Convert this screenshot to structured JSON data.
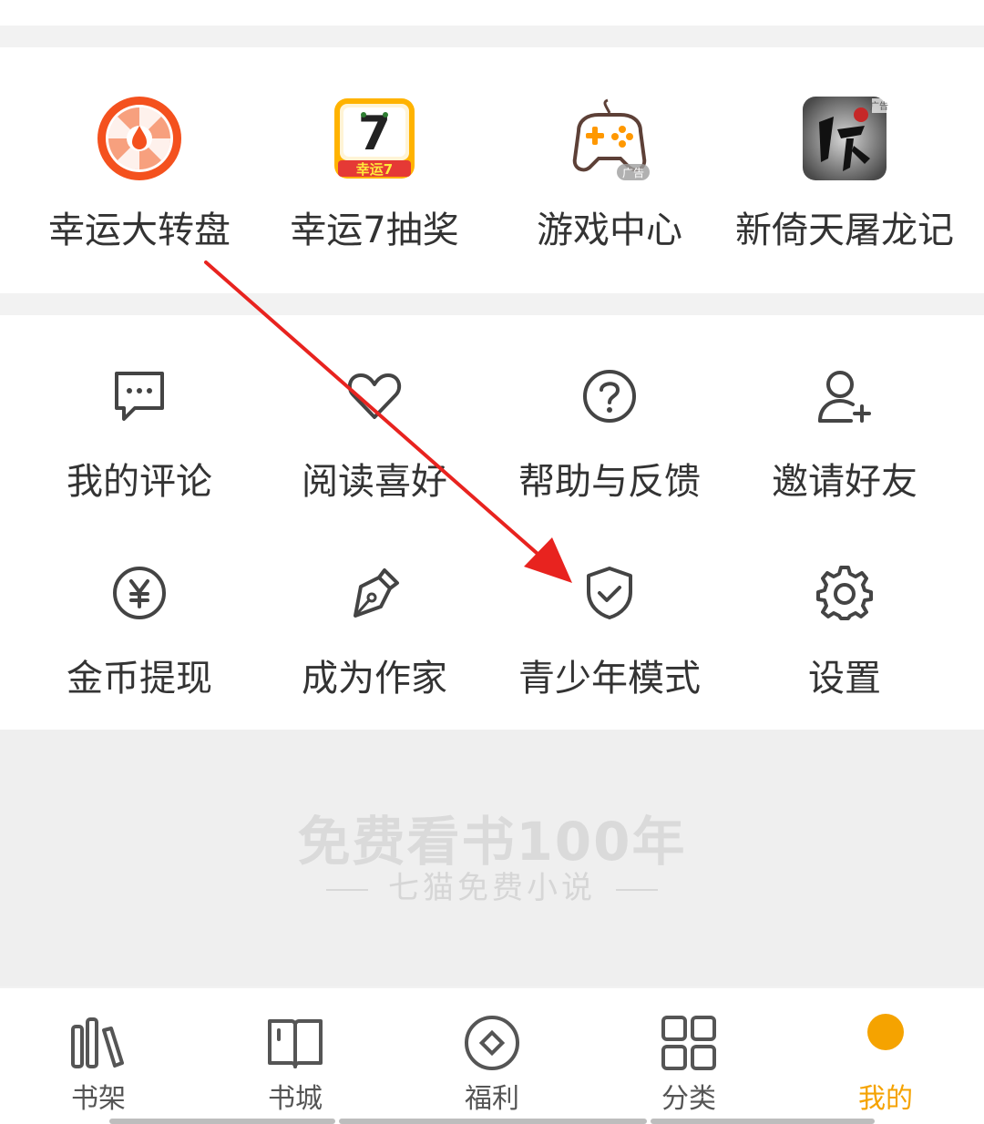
{
  "promo": {
    "items": [
      {
        "label": "幸运大转盘",
        "icon": "wheel-icon"
      },
      {
        "label": "幸运7抽奖",
        "icon": "lucky7-icon",
        "badge": "幸运7"
      },
      {
        "label": "游戏中心",
        "icon": "gamepad-icon",
        "ad": "广告"
      },
      {
        "label": "新倚天屠龙记",
        "icon": "game-ad-icon",
        "ad": "广告"
      }
    ]
  },
  "menu": {
    "items": [
      {
        "label": "我的评论",
        "icon": "comment-icon"
      },
      {
        "label": "阅读喜好",
        "icon": "heart-icon"
      },
      {
        "label": "帮助与反馈",
        "icon": "help-icon"
      },
      {
        "label": "邀请好友",
        "icon": "add-user-icon"
      },
      {
        "label": "金币提现",
        "icon": "yen-icon"
      },
      {
        "label": "成为作家",
        "icon": "pen-icon"
      },
      {
        "label": "青少年模式",
        "icon": "shield-check-icon"
      },
      {
        "label": "设置",
        "icon": "gear-icon"
      }
    ]
  },
  "banner": {
    "title": "免费看书100年",
    "subtitle": "七猫免费小说"
  },
  "tabbar": {
    "items": [
      {
        "label": "书架",
        "icon": "bookshelf-icon"
      },
      {
        "label": "书城",
        "icon": "book-icon"
      },
      {
        "label": "福利",
        "icon": "diamond-icon"
      },
      {
        "label": "分类",
        "icon": "grid-icon"
      },
      {
        "label": "我的",
        "icon": "profile-dot-icon",
        "active": true
      }
    ]
  },
  "colors": {
    "accent": "#f5a300",
    "wheel": "#f4511e",
    "arrow": "#e8231f"
  }
}
